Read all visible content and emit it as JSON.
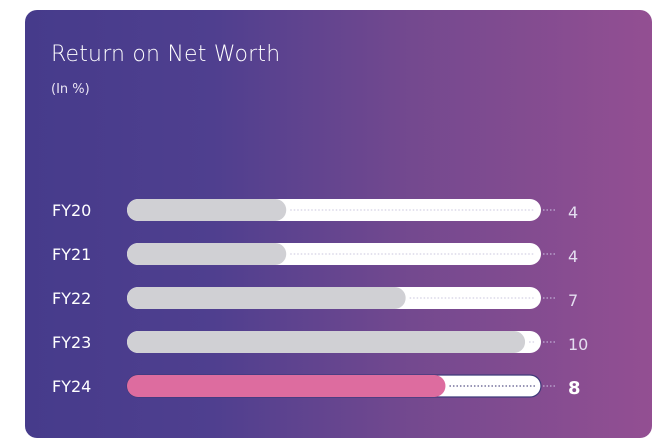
{
  "chart_data": {
    "type": "bar",
    "title": "Return on Net Worth",
    "subtitle": "(In %)",
    "categories": [
      "FY20",
      "FY21",
      "FY22",
      "FY23",
      "FY24"
    ],
    "values": [
      4,
      4,
      7,
      10,
      8
    ],
    "value_labels": [
      "4",
      "4",
      "7",
      "10",
      "8"
    ],
    "highlight_index": 4,
    "orientation": "horizontal",
    "xlim": [
      0,
      10.4
    ],
    "grid": false,
    "colors": {
      "bar": "#d0d0d4",
      "highlight_bar": "#dd6c9f",
      "track": "#ffffff",
      "connector": "#cfc6e6"
    }
  }
}
